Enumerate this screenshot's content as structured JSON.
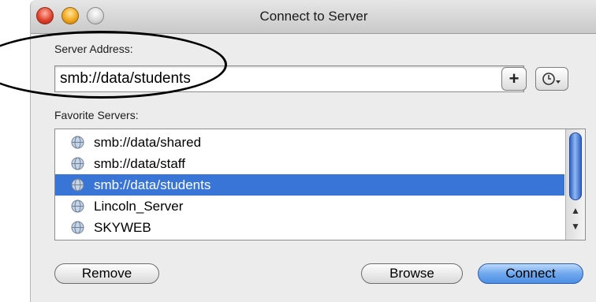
{
  "window": {
    "title": "Connect to Server"
  },
  "server_address": {
    "label": "Server Address:",
    "value": "smb://data/students"
  },
  "buttons": {
    "add": "+",
    "remove": "Remove",
    "browse": "Browse",
    "connect": "Connect"
  },
  "favorites": {
    "label": "Favorite Servers:",
    "items": [
      {
        "label": "smb://data/shared",
        "selected": false
      },
      {
        "label": "smb://data/staff",
        "selected": false
      },
      {
        "label": "smb://data/students",
        "selected": true
      },
      {
        "label": "Lincoln_Server",
        "selected": false
      },
      {
        "label": "SKYWEB",
        "selected": false
      }
    ]
  },
  "icons": {
    "server": "globe-server-icon",
    "recent": "clock-menu-icon"
  },
  "colors": {
    "selection": "#3875d7",
    "default_button": "#6fa8ee",
    "annotation_oval": "#000000"
  }
}
